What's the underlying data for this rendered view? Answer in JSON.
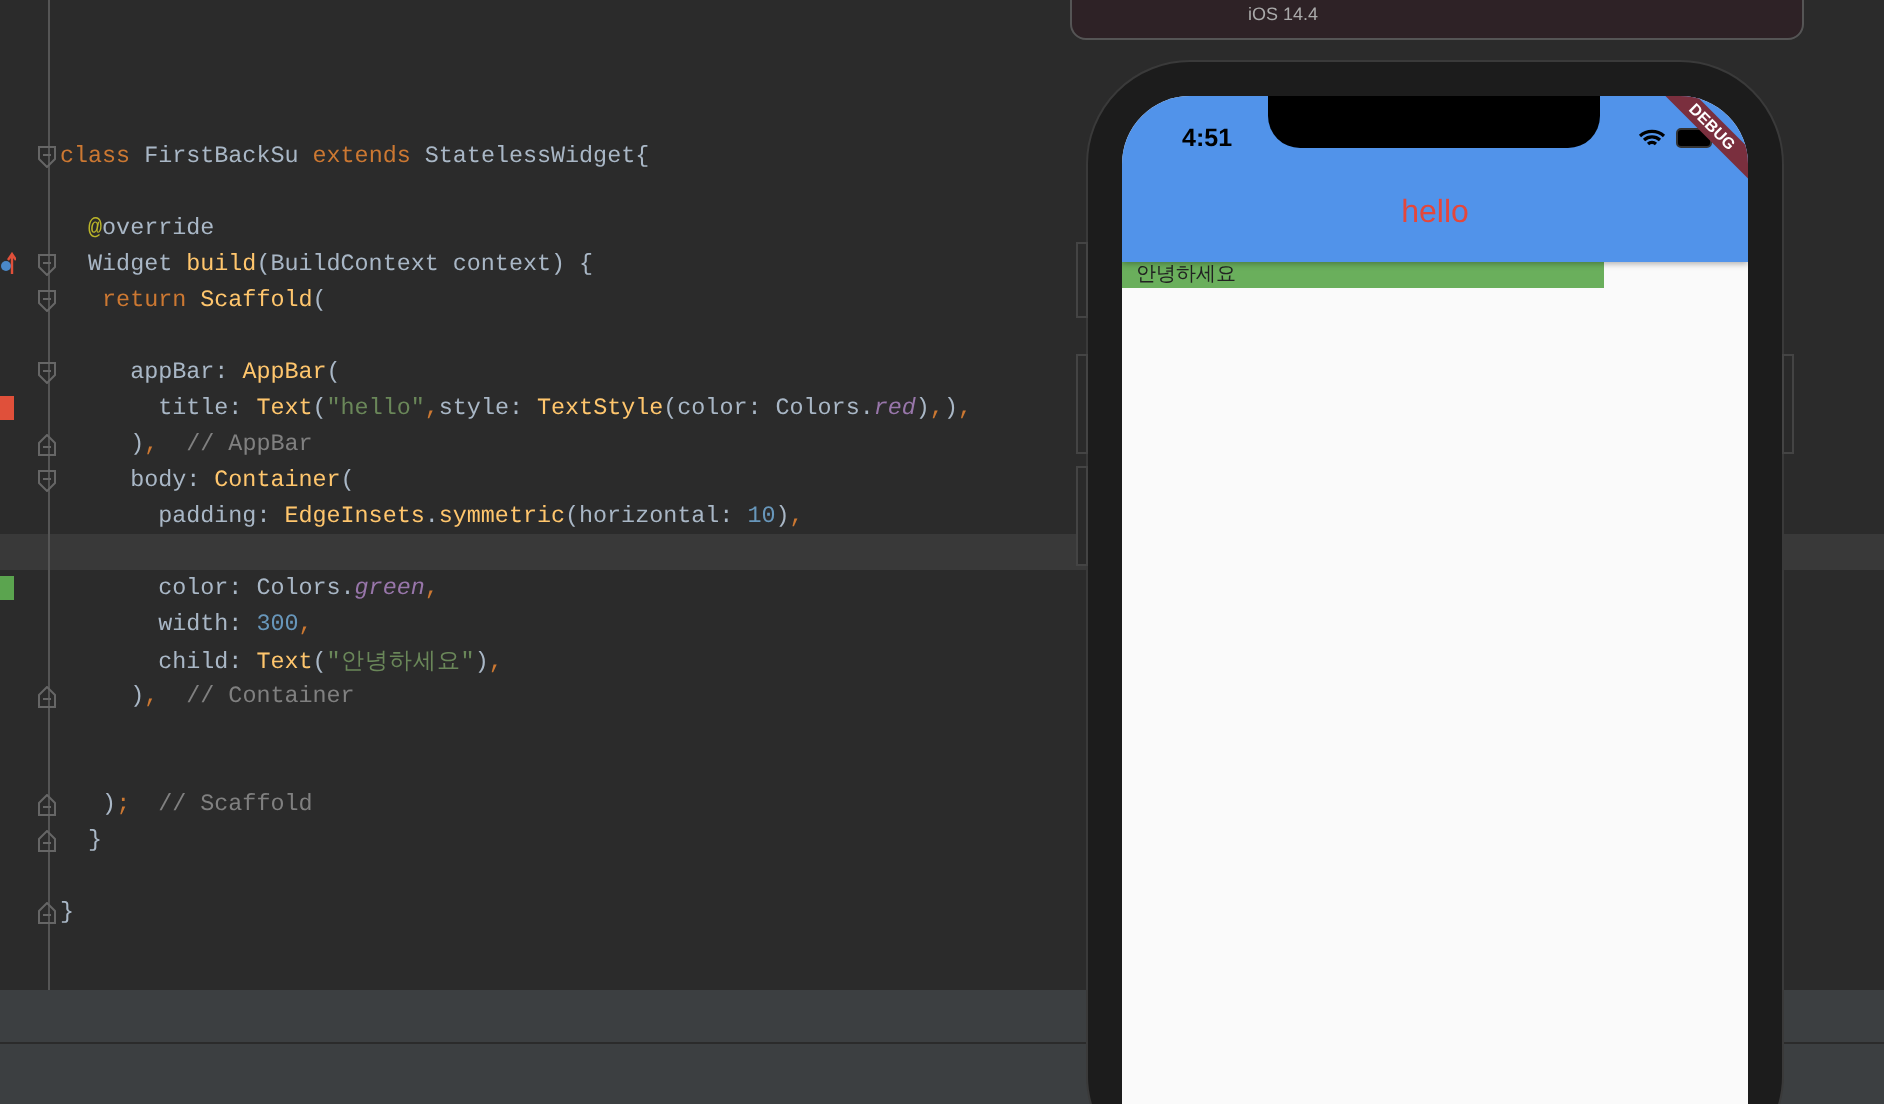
{
  "top_window": {
    "subtitle": "iOS 14.4"
  },
  "editor": {
    "lines": [
      {
        "kind": "code",
        "fold_start": true,
        "tokens": [
          {
            "kind": "kw",
            "text": "class"
          },
          {
            "kind": "plain",
            "text": " FirstBackSu "
          },
          {
            "kind": "kw",
            "text": "extends"
          },
          {
            "kind": "plain",
            "text": " StatelessWidget{"
          }
        ]
      },
      {
        "kind": "blank"
      },
      {
        "kind": "code",
        "tokens": [
          {
            "kind": "ann",
            "text": "  @"
          },
          {
            "kind": "plain",
            "text": "override"
          }
        ]
      },
      {
        "kind": "code",
        "fold_start": true,
        "overrides": true,
        "tokens": [
          {
            "kind": "plain",
            "text": "  Widget "
          },
          {
            "kind": "type",
            "text": "build"
          },
          {
            "kind": "plain",
            "text": "(BuildContext context) {"
          }
        ]
      },
      {
        "kind": "code",
        "fold_start": true,
        "tokens": [
          {
            "kind": "kw",
            "text": "   return "
          },
          {
            "kind": "type",
            "text": "Scaffold"
          },
          {
            "kind": "plain",
            "text": "("
          }
        ]
      },
      {
        "kind": "blank"
      },
      {
        "kind": "code",
        "fold_start": true,
        "tokens": [
          {
            "kind": "plain",
            "text": "     appBar: "
          },
          {
            "kind": "type",
            "text": "AppBar"
          },
          {
            "kind": "plain",
            "text": "("
          }
        ]
      },
      {
        "kind": "code",
        "modified": true,
        "tokens": [
          {
            "kind": "plain",
            "text": "       title: "
          },
          {
            "kind": "type",
            "text": "Text"
          },
          {
            "kind": "plain",
            "text": "("
          },
          {
            "kind": "str",
            "text": "\"hello\""
          },
          {
            "kind": "kw",
            "text": ","
          },
          {
            "kind": "plain",
            "text": "style: "
          },
          {
            "kind": "type",
            "text": "TextStyle"
          },
          {
            "kind": "plain",
            "text": "(color: Colors."
          },
          {
            "kind": "const",
            "text": "red"
          },
          {
            "kind": "plain",
            "text": ")"
          },
          {
            "kind": "kw",
            "text": ","
          },
          {
            "kind": "plain",
            "text": ")"
          },
          {
            "kind": "kw",
            "text": ","
          }
        ]
      },
      {
        "kind": "code",
        "fold_end": true,
        "tokens": [
          {
            "kind": "plain",
            "text": "     )"
          },
          {
            "kind": "kw",
            "text": ","
          },
          {
            "kind": "cmt",
            "text": "  // AppBar"
          }
        ]
      },
      {
        "kind": "code",
        "fold_start": true,
        "tokens": [
          {
            "kind": "plain",
            "text": "     body: "
          },
          {
            "kind": "type",
            "text": "Container"
          },
          {
            "kind": "plain",
            "text": "("
          }
        ]
      },
      {
        "kind": "code",
        "tokens": [
          {
            "kind": "plain",
            "text": "       padding: "
          },
          {
            "kind": "type",
            "text": "EdgeInsets"
          },
          {
            "kind": "plain",
            "text": "."
          },
          {
            "kind": "type",
            "text": "symmetric"
          },
          {
            "kind": "plain",
            "text": "(horizontal: "
          },
          {
            "kind": "num",
            "text": "10"
          },
          {
            "kind": "plain",
            "text": ")"
          },
          {
            "kind": "kw",
            "text": ","
          }
        ]
      },
      {
        "kind": "blank",
        "current": true
      },
      {
        "kind": "code",
        "added": true,
        "tokens": [
          {
            "kind": "plain",
            "text": "       color: Colors."
          },
          {
            "kind": "const",
            "text": "green"
          },
          {
            "kind": "kw",
            "text": ","
          }
        ]
      },
      {
        "kind": "code",
        "tokens": [
          {
            "kind": "plain",
            "text": "       width: "
          },
          {
            "kind": "num",
            "text": "300"
          },
          {
            "kind": "kw",
            "text": ","
          }
        ]
      },
      {
        "kind": "code",
        "tokens": [
          {
            "kind": "plain",
            "text": "       child: "
          },
          {
            "kind": "type",
            "text": "Text"
          },
          {
            "kind": "plain",
            "text": "("
          },
          {
            "kind": "str",
            "text": "\"안녕하세요\""
          },
          {
            "kind": "plain",
            "text": ")"
          },
          {
            "kind": "kw",
            "text": ","
          }
        ]
      },
      {
        "kind": "code",
        "fold_end": true,
        "tokens": [
          {
            "kind": "plain",
            "text": "     )"
          },
          {
            "kind": "kw",
            "text": ","
          },
          {
            "kind": "cmt",
            "text": "  // Container"
          }
        ]
      },
      {
        "kind": "blank"
      },
      {
        "kind": "blank"
      },
      {
        "kind": "code",
        "fold_end": true,
        "tokens": [
          {
            "kind": "plain",
            "text": "   )"
          },
          {
            "kind": "kw",
            "text": ";"
          },
          {
            "kind": "cmt",
            "text": "  // Scaffold"
          }
        ]
      },
      {
        "kind": "code",
        "fold_end": true,
        "tokens": [
          {
            "kind": "plain",
            "text": "  }"
          }
        ]
      },
      {
        "kind": "blank"
      },
      {
        "kind": "code",
        "fold_end": true,
        "tokens": [
          {
            "kind": "plain",
            "text": "}"
          }
        ]
      }
    ]
  },
  "phone": {
    "time": "4:51",
    "banner": "DEBUG",
    "app_bar": {
      "title": "hello"
    },
    "body": {
      "text": "안녕하세요"
    }
  }
}
